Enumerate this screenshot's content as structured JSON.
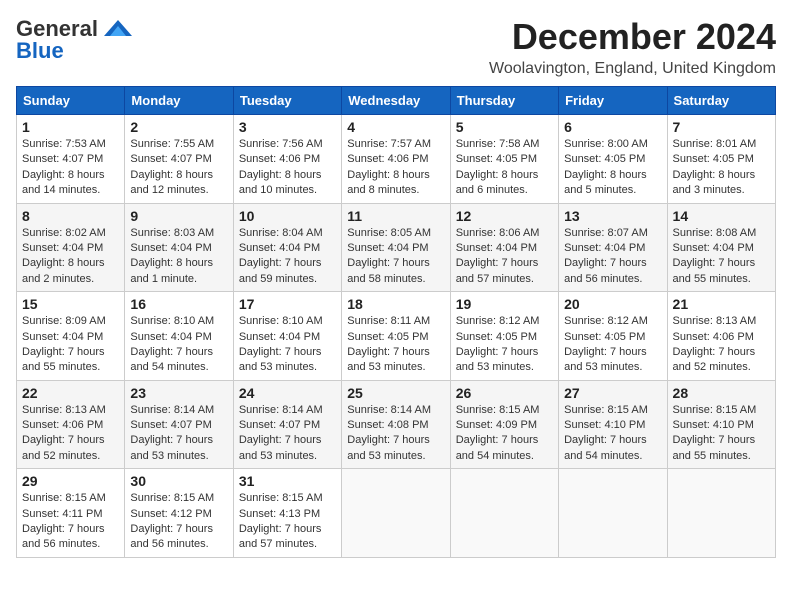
{
  "header": {
    "logo_general": "General",
    "logo_blue": "Blue",
    "month_year": "December 2024",
    "location": "Woolavington, England, United Kingdom"
  },
  "weekdays": [
    "Sunday",
    "Monday",
    "Tuesday",
    "Wednesday",
    "Thursday",
    "Friday",
    "Saturday"
  ],
  "weeks": [
    [
      {
        "day": "1",
        "sunrise": "7:53 AM",
        "sunset": "4:07 PM",
        "daylight": "8 hours and 14 minutes."
      },
      {
        "day": "2",
        "sunrise": "7:55 AM",
        "sunset": "4:07 PM",
        "daylight": "8 hours and 12 minutes."
      },
      {
        "day": "3",
        "sunrise": "7:56 AM",
        "sunset": "4:06 PM",
        "daylight": "8 hours and 10 minutes."
      },
      {
        "day": "4",
        "sunrise": "7:57 AM",
        "sunset": "4:06 PM",
        "daylight": "8 hours and 8 minutes."
      },
      {
        "day": "5",
        "sunrise": "7:58 AM",
        "sunset": "4:05 PM",
        "daylight": "8 hours and 6 minutes."
      },
      {
        "day": "6",
        "sunrise": "8:00 AM",
        "sunset": "4:05 PM",
        "daylight": "8 hours and 5 minutes."
      },
      {
        "day": "7",
        "sunrise": "8:01 AM",
        "sunset": "4:05 PM",
        "daylight": "8 hours and 3 minutes."
      }
    ],
    [
      {
        "day": "8",
        "sunrise": "8:02 AM",
        "sunset": "4:04 PM",
        "daylight": "8 hours and 2 minutes."
      },
      {
        "day": "9",
        "sunrise": "8:03 AM",
        "sunset": "4:04 PM",
        "daylight": "8 hours and 1 minute."
      },
      {
        "day": "10",
        "sunrise": "8:04 AM",
        "sunset": "4:04 PM",
        "daylight": "7 hours and 59 minutes."
      },
      {
        "day": "11",
        "sunrise": "8:05 AM",
        "sunset": "4:04 PM",
        "daylight": "7 hours and 58 minutes."
      },
      {
        "day": "12",
        "sunrise": "8:06 AM",
        "sunset": "4:04 PM",
        "daylight": "7 hours and 57 minutes."
      },
      {
        "day": "13",
        "sunrise": "8:07 AM",
        "sunset": "4:04 PM",
        "daylight": "7 hours and 56 minutes."
      },
      {
        "day": "14",
        "sunrise": "8:08 AM",
        "sunset": "4:04 PM",
        "daylight": "7 hours and 55 minutes."
      }
    ],
    [
      {
        "day": "15",
        "sunrise": "8:09 AM",
        "sunset": "4:04 PM",
        "daylight": "7 hours and 55 minutes."
      },
      {
        "day": "16",
        "sunrise": "8:10 AM",
        "sunset": "4:04 PM",
        "daylight": "7 hours and 54 minutes."
      },
      {
        "day": "17",
        "sunrise": "8:10 AM",
        "sunset": "4:04 PM",
        "daylight": "7 hours and 53 minutes."
      },
      {
        "day": "18",
        "sunrise": "8:11 AM",
        "sunset": "4:05 PM",
        "daylight": "7 hours and 53 minutes."
      },
      {
        "day": "19",
        "sunrise": "8:12 AM",
        "sunset": "4:05 PM",
        "daylight": "7 hours and 53 minutes."
      },
      {
        "day": "20",
        "sunrise": "8:12 AM",
        "sunset": "4:05 PM",
        "daylight": "7 hours and 53 minutes."
      },
      {
        "day": "21",
        "sunrise": "8:13 AM",
        "sunset": "4:06 PM",
        "daylight": "7 hours and 52 minutes."
      }
    ],
    [
      {
        "day": "22",
        "sunrise": "8:13 AM",
        "sunset": "4:06 PM",
        "daylight": "7 hours and 52 minutes."
      },
      {
        "day": "23",
        "sunrise": "8:14 AM",
        "sunset": "4:07 PM",
        "daylight": "7 hours and 53 minutes."
      },
      {
        "day": "24",
        "sunrise": "8:14 AM",
        "sunset": "4:07 PM",
        "daylight": "7 hours and 53 minutes."
      },
      {
        "day": "25",
        "sunrise": "8:14 AM",
        "sunset": "4:08 PM",
        "daylight": "7 hours and 53 minutes."
      },
      {
        "day": "26",
        "sunrise": "8:15 AM",
        "sunset": "4:09 PM",
        "daylight": "7 hours and 54 minutes."
      },
      {
        "day": "27",
        "sunrise": "8:15 AM",
        "sunset": "4:10 PM",
        "daylight": "7 hours and 54 minutes."
      },
      {
        "day": "28",
        "sunrise": "8:15 AM",
        "sunset": "4:10 PM",
        "daylight": "7 hours and 55 minutes."
      }
    ],
    [
      {
        "day": "29",
        "sunrise": "8:15 AM",
        "sunset": "4:11 PM",
        "daylight": "7 hours and 56 minutes."
      },
      {
        "day": "30",
        "sunrise": "8:15 AM",
        "sunset": "4:12 PM",
        "daylight": "7 hours and 56 minutes."
      },
      {
        "day": "31",
        "sunrise": "8:15 AM",
        "sunset": "4:13 PM",
        "daylight": "7 hours and 57 minutes."
      },
      null,
      null,
      null,
      null
    ]
  ]
}
